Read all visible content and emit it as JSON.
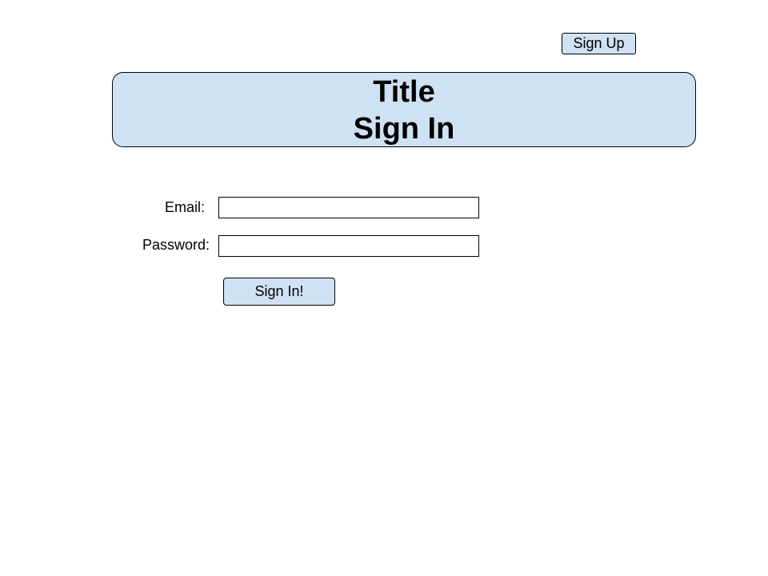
{
  "header": {
    "title": "Title",
    "subtitle": "Sign In",
    "signup_label": "Sign Up"
  },
  "form": {
    "email_label": "Email:",
    "email_value": "",
    "password_label": "Password:",
    "password_value": "",
    "submit_label": "Sign In!"
  },
  "colors": {
    "panel_fill": "#cfe2f3",
    "border": "#000000",
    "background": "#ffffff"
  }
}
